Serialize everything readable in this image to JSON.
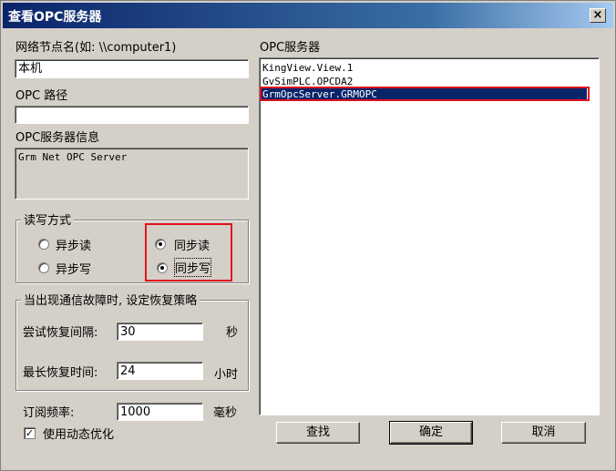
{
  "window": {
    "title": "查看OPC服务器",
    "close_label": "×"
  },
  "node": {
    "label": "网络节点名(如: \\\\computer1)",
    "value": "本机"
  },
  "path": {
    "label": "OPC 路径",
    "value": ""
  },
  "info": {
    "label": "OPC服务器信息",
    "value": "Grm Net OPC Server"
  },
  "rw_mode": {
    "title": "读写方式",
    "options": [
      "异步读",
      "同步读",
      "异步写",
      "同步写"
    ],
    "selected": [
      "同步读",
      "同步写"
    ]
  },
  "recovery": {
    "title": "当出现通信故障时, 设定恢复策略",
    "retry_label": "尝试恢复间隔:",
    "retry_value": "30",
    "retry_unit": "秒",
    "max_label": "最长恢复时间:",
    "max_value": "24",
    "max_unit": "小时"
  },
  "subscribe": {
    "label": "订阅频率:",
    "value": "1000",
    "unit": "毫秒"
  },
  "dynamic_opt": {
    "label": "使用动态优化",
    "checked": true,
    "check_glyph": "✓"
  },
  "servers": {
    "label": "OPC服务器",
    "items": [
      "KingView.View.1",
      "GvSimPLC.OPCDA2",
      "GrmOpcServer.GRMOPC"
    ],
    "selected": "GrmOpcServer.GRMOPC"
  },
  "buttons": {
    "find": "查找",
    "ok": "确定",
    "cancel": "取消"
  },
  "colors": {
    "highlight": "#e0131e",
    "selection": "#0a246a"
  }
}
